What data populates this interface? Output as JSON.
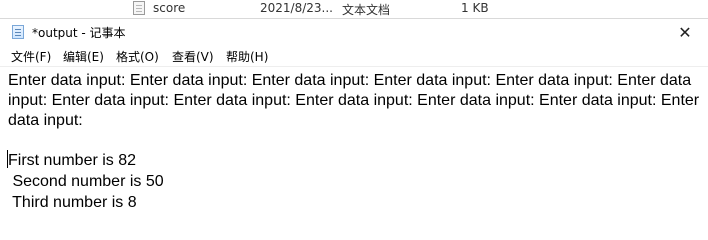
{
  "explorer": {
    "file_name": "score",
    "modified": "2021/8/23...",
    "type": "文本文档",
    "size": "1 KB"
  },
  "window": {
    "title": "*output - 记事本",
    "close_glyph": "✕"
  },
  "menu": [
    {
      "label": "文件(F)"
    },
    {
      "label": "编辑(E)"
    },
    {
      "label": "格式(O)"
    },
    {
      "label": "查看(V)"
    },
    {
      "label": "帮助(H)"
    }
  ],
  "editor": {
    "lines": [
      "Enter data input: Enter data input: Enter data input: Enter data input: Enter data input: Enter data",
      "input: Enter data input: Enter data input: Enter data input: Enter data input: Enter data input: Enter",
      "data input:",
      "",
      "First number is 82",
      " Second number is 50",
      " Third number is 8"
    ]
  }
}
